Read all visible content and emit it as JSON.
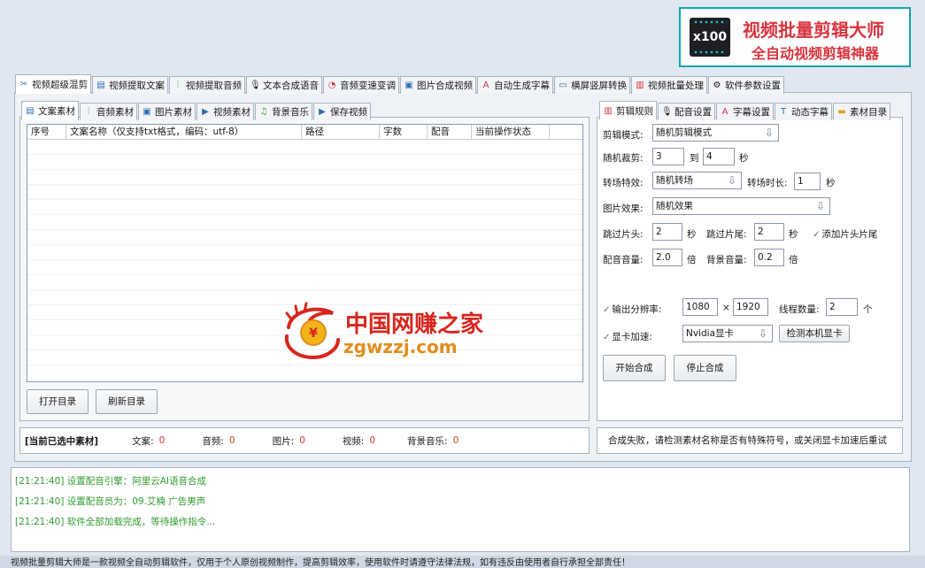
{
  "logo": {
    "icon_text": "x100",
    "title": "视频批量剪辑大师",
    "subtitle": "全自动视频剪辑神器"
  },
  "main_tabs": [
    {
      "label": "视频超级混剪",
      "icon": "scissors-icon"
    },
    {
      "label": "视频提取文案",
      "icon": "document-icon"
    },
    {
      "label": "视频提取音频",
      "icon": "audio-wave-icon"
    },
    {
      "label": "文本合成语音",
      "icon": "microphone-icon"
    },
    {
      "label": "音频变速变调",
      "icon": "gauge-icon"
    },
    {
      "label": "图片合成视频",
      "icon": "image-icon"
    },
    {
      "label": "自动生成字幕",
      "icon": "font-icon"
    },
    {
      "label": "横屏竖屏转换",
      "icon": "rotate-icon"
    },
    {
      "label": "视频批量处理",
      "icon": "film-icon"
    },
    {
      "label": "软件参数设置",
      "icon": "gear-icon"
    }
  ],
  "left_tabs": [
    {
      "label": "文案素材",
      "icon": "document-icon"
    },
    {
      "label": "音频素材",
      "icon": "audio-wave-icon"
    },
    {
      "label": "图片素材",
      "icon": "image-icon"
    },
    {
      "label": "视频素材",
      "icon": "play-icon"
    },
    {
      "label": "背景音乐",
      "icon": "music-note-icon"
    },
    {
      "label": "保存视频",
      "icon": "save-icon"
    }
  ],
  "grid": {
    "columns": [
      "序号",
      "文案名称（仅支持txt格式，编码：utf-8）",
      "路径",
      "字数",
      "配音",
      "当前操作状态"
    ]
  },
  "buttons": {
    "open_dir": "打开目录",
    "refresh_dir": "刷新目录",
    "start": "开始合成",
    "stop": "停止合成",
    "detect_gpu": "检测本机显卡"
  },
  "selected": {
    "title": "[当前已选中素材]",
    "items": [
      {
        "label": "文案:",
        "value": "0"
      },
      {
        "label": "音频:",
        "value": "0"
      },
      {
        "label": "图片:",
        "value": "0"
      },
      {
        "label": "视频:",
        "value": "0"
      },
      {
        "label": "背景音乐:",
        "value": "0"
      }
    ]
  },
  "right_tabs": [
    {
      "label": "剪辑规则",
      "icon": "film-icon"
    },
    {
      "label": "配音设置",
      "icon": "microphone-icon"
    },
    {
      "label": "字幕设置",
      "icon": "font-icon"
    },
    {
      "label": "动态字幕",
      "icon": "text-box-icon"
    },
    {
      "label": "素材目录",
      "icon": "folder-icon"
    }
  ],
  "settings": {
    "edit_mode_label": "剪辑模式:",
    "edit_mode": "随机剪辑模式",
    "random_cut_label": "随机裁剪:",
    "random_cut_from": "3",
    "to": "到",
    "random_cut_to": "4",
    "sec": "秒",
    "transition_label": "转场特效:",
    "transition": "随机转场",
    "transition_dur_label": "转场时长:",
    "transition_dur": "1",
    "image_effect_label": "图片效果:",
    "image_effect": "随机效果",
    "skip_head_label": "跳过片头:",
    "skip_head": "2",
    "skip_tail_label": "跳过片尾:",
    "skip_tail": "2",
    "add_head_tail": "添加片头片尾",
    "voice_vol_label": "配音音量:",
    "voice_vol": "2.0",
    "times": "倍",
    "bgm_vol_label": "背景音量:",
    "bgm_vol": "0.2",
    "output_res_label": "输出分辨率:",
    "res_w": "1080",
    "x": "×",
    "res_h": "1920",
    "threads_label": "线程数量:",
    "threads": "2",
    "unit": "个",
    "gpu_label": "显卡加速:",
    "gpu": "Nvidia显卡"
  },
  "error_message": "合成失败，请检测素材名称是否有特殊符号，或关闭显卡加速后重试",
  "log": [
    "[21:21:40] 设置配音引擎：阿里云AI语音合成",
    "[21:21:40] 设置配音员为：09.艾楠 广告男声",
    "[21:21:40] 软件全部加载完成，等待操作指令..."
  ],
  "footer": "视频批量剪辑大师是一款视频全自动剪辑软件，仅用于个人原创视频制作，提高剪辑效率，使用软件时请遵守法律法规，如有违反由使用者自行承担全部责任！",
  "watermark": {
    "text": "中国网赚之家",
    "url": "zgwzzj.com"
  },
  "colors": {
    "accent_red": "#d8343f",
    "log_green": "#2f9a2f",
    "logo_border": "#19a3b0"
  }
}
